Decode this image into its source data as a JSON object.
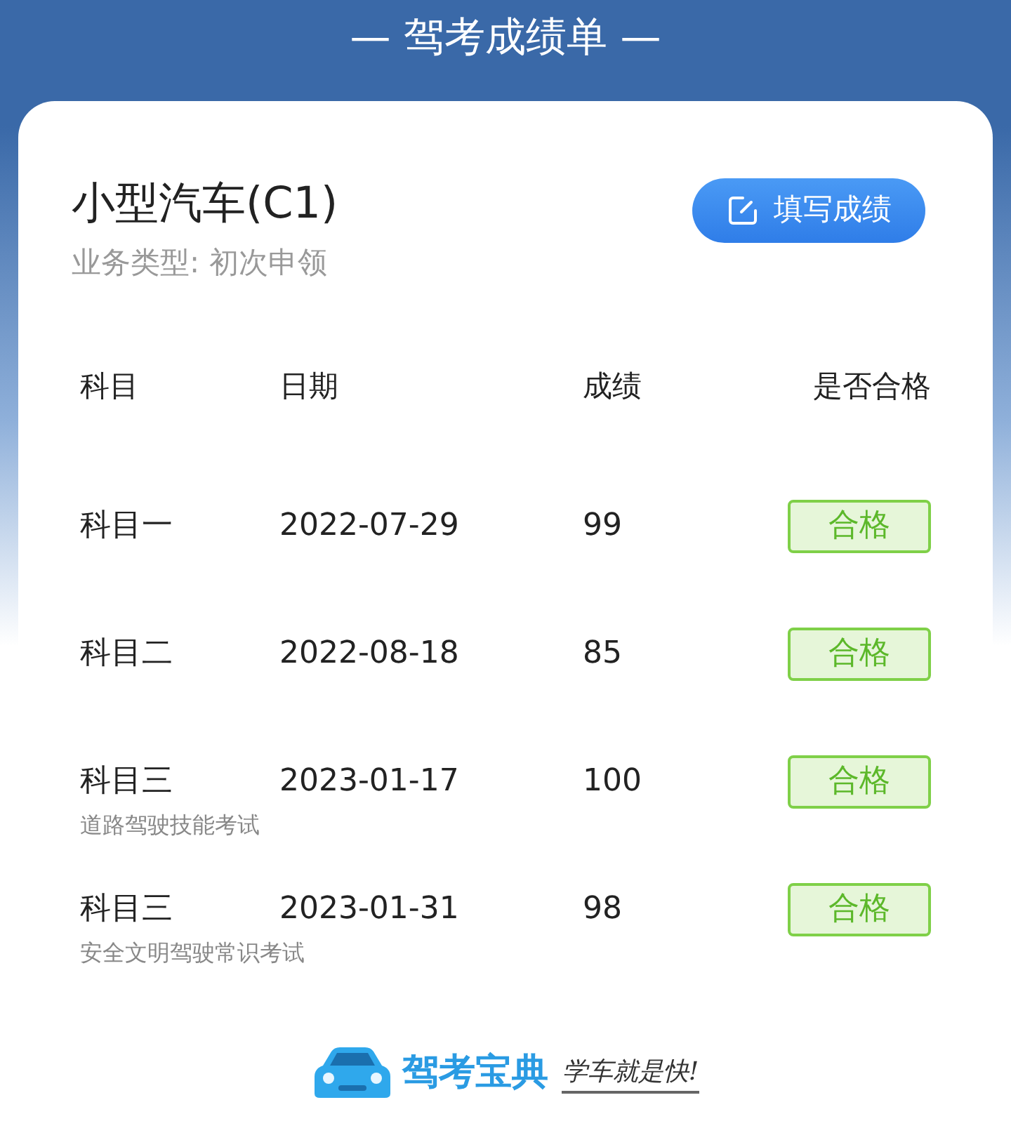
{
  "header": {
    "title": "— 驾考成绩单 —"
  },
  "card": {
    "title": "小型汽车(C1)",
    "subtitle": "业务类型: 初次申领",
    "button": "填写成绩"
  },
  "table": {
    "columns": [
      "科目",
      "日期",
      "成绩",
      "是否合格"
    ],
    "rows": [
      {
        "subject": "科目一",
        "note": "",
        "date": "2022-07-29",
        "score": "99",
        "result": "合格",
        "passed": true
      },
      {
        "subject": "科目二",
        "note": "",
        "date": "2022-08-18",
        "score": "85",
        "result": "合格",
        "passed": true
      },
      {
        "subject": "科目三",
        "note": "道路驾驶技能考试",
        "date": "2023-01-17",
        "score": "100",
        "result": "合格",
        "passed": true
      },
      {
        "subject": "科目三",
        "note": "安全文明驾驶常识考试",
        "date": "2023-01-31",
        "score": "98",
        "result": "合格",
        "passed": true
      }
    ]
  },
  "footer": {
    "brand": "驾考宝典",
    "slogan": "学车就是快!"
  }
}
